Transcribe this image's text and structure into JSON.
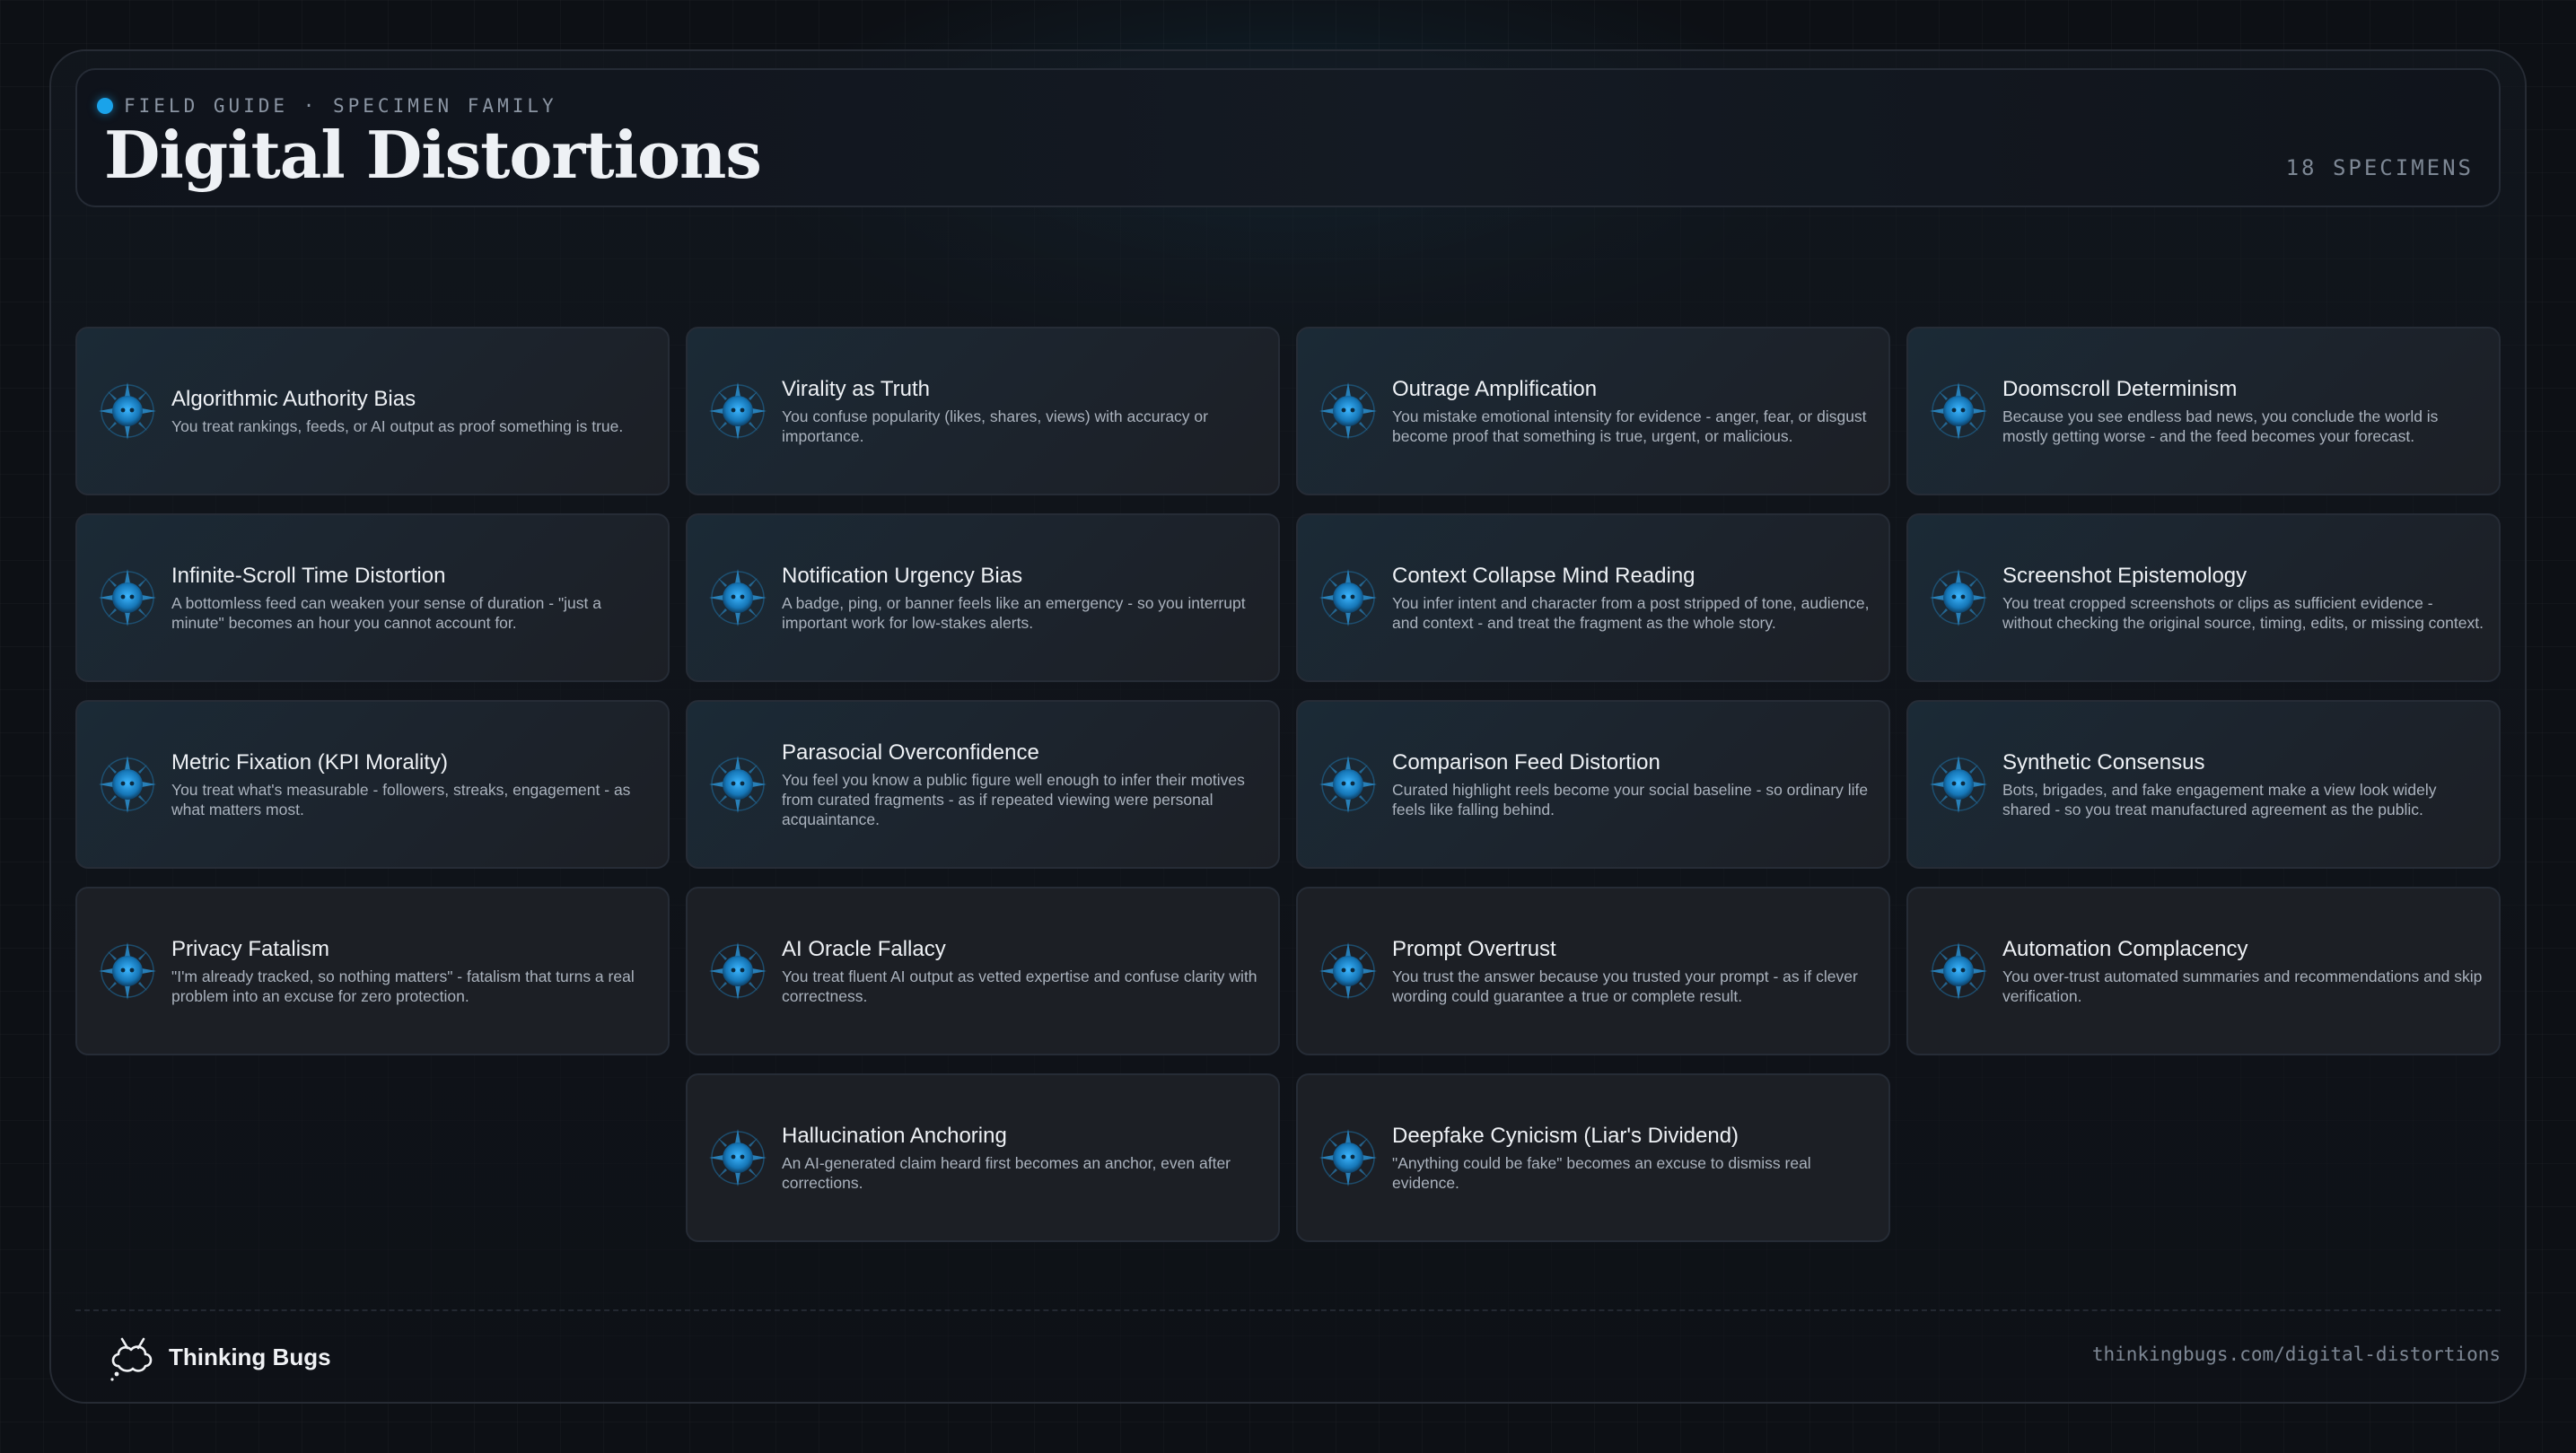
{
  "header": {
    "eyebrow": "FIELD GUIDE · SPECIMEN FAMILY",
    "title": "Digital Distortions",
    "count": "18 SPECIMENS"
  },
  "icon": "bug-specimen-icon",
  "accent": "#1aa3ea",
  "cards": [
    {
      "name": "Algorithmic Authority Bias",
      "desc": "You treat rankings, feeds, or AI output as proof something is true."
    },
    {
      "name": "Virality as Truth",
      "desc": "You confuse popularity (likes, shares, views) with accuracy or importance."
    },
    {
      "name": "Outrage Amplification",
      "desc": "You mistake emotional intensity for evidence - anger, fear, or disgust become proof that something is true, urgent, or malicious."
    },
    {
      "name": "Doomscroll Determinism",
      "desc": "Because you see endless bad news, you conclude the world is mostly getting worse - and the feed becomes your forecast."
    },
    {
      "name": "Infinite-Scroll Time Distortion",
      "desc": "A bottomless feed can weaken your sense of duration - \"just a minute\" becomes an hour you cannot account for."
    },
    {
      "name": "Notification Urgency Bias",
      "desc": "A badge, ping, or banner feels like an emergency - so you interrupt important work for low-stakes alerts."
    },
    {
      "name": "Context Collapse Mind Reading",
      "desc": "You infer intent and character from a post stripped of tone, audience, and context - and treat the fragment as the whole story."
    },
    {
      "name": "Screenshot Epistemology",
      "desc": "You treat cropped screenshots or clips as sufficient evidence - without checking the original source, timing, edits, or missing context."
    },
    {
      "name": "Metric Fixation (KPI Morality)",
      "desc": "You treat what's measurable - followers, streaks, engagement - as what matters most."
    },
    {
      "name": "Parasocial Overconfidence",
      "desc": "You feel you know a public figure well enough to infer their motives from curated fragments - as if repeated viewing were personal acquaintance."
    },
    {
      "name": "Comparison Feed Distortion",
      "desc": "Curated highlight reels become your social baseline - so ordinary life feels like falling behind."
    },
    {
      "name": "Synthetic Consensus",
      "desc": "Bots, brigades, and fake engagement make a view look widely shared - so you treat manufactured agreement as the public."
    },
    {
      "name": "Privacy Fatalism",
      "desc": "\"I'm already tracked, so nothing matters\" - fatalism that turns a real problem into an excuse for zero protection."
    },
    {
      "name": "AI Oracle Fallacy",
      "desc": "You treat fluent AI output as vetted expertise and confuse clarity with correctness."
    },
    {
      "name": "Prompt Overtrust",
      "desc": "You trust the answer because you trusted your prompt - as if clever wording could guarantee a true or complete result."
    },
    {
      "name": "Automation Complacency",
      "desc": "You over-trust automated summaries and recommendations and skip verification."
    },
    {
      "name": "Hallucination Anchoring",
      "desc": "An AI-generated claim heard first becomes an anchor, even after corrections."
    },
    {
      "name": "Deepfake Cynicism (Liar's Dividend)",
      "desc": "\"Anything could be fake\" becomes an excuse to dismiss real evidence."
    }
  ],
  "footer": {
    "brand": "Thinking Bugs",
    "brand_icon": "bug-logo-icon",
    "url": "thinkingbugs.com/digital-distortions"
  }
}
